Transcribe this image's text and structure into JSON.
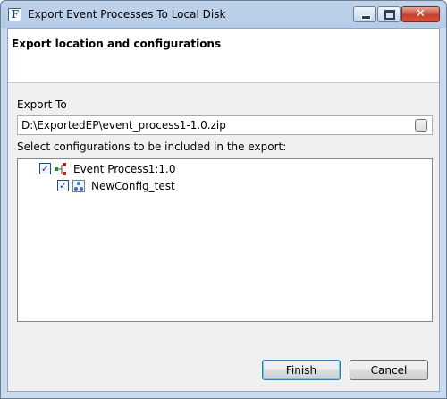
{
  "window": {
    "title": "Export Event Processes To Local Disk",
    "app_icon_letter": "F"
  },
  "header": {
    "title": "Export location and configurations"
  },
  "export_to": {
    "label": "Export To",
    "path": "D:\\ExportedEP\\event_process1-1.0.zip"
  },
  "configurations": {
    "label": "Select configurations to be included in the export:",
    "tree": [
      {
        "label": "Event Process1:1.0",
        "checked": true,
        "icon": "event-process-icon",
        "level": 0
      },
      {
        "label": "NewConfig_test",
        "checked": true,
        "icon": "config-icon",
        "level": 1
      }
    ]
  },
  "buttons": {
    "finish": "Finish",
    "cancel": "Cancel"
  },
  "colors": {
    "title_bar": "#b5cbe6",
    "dialog_bg": "#f0f0f0",
    "default_button_border": "#3c7fb1",
    "close_button": "#c6402d"
  }
}
